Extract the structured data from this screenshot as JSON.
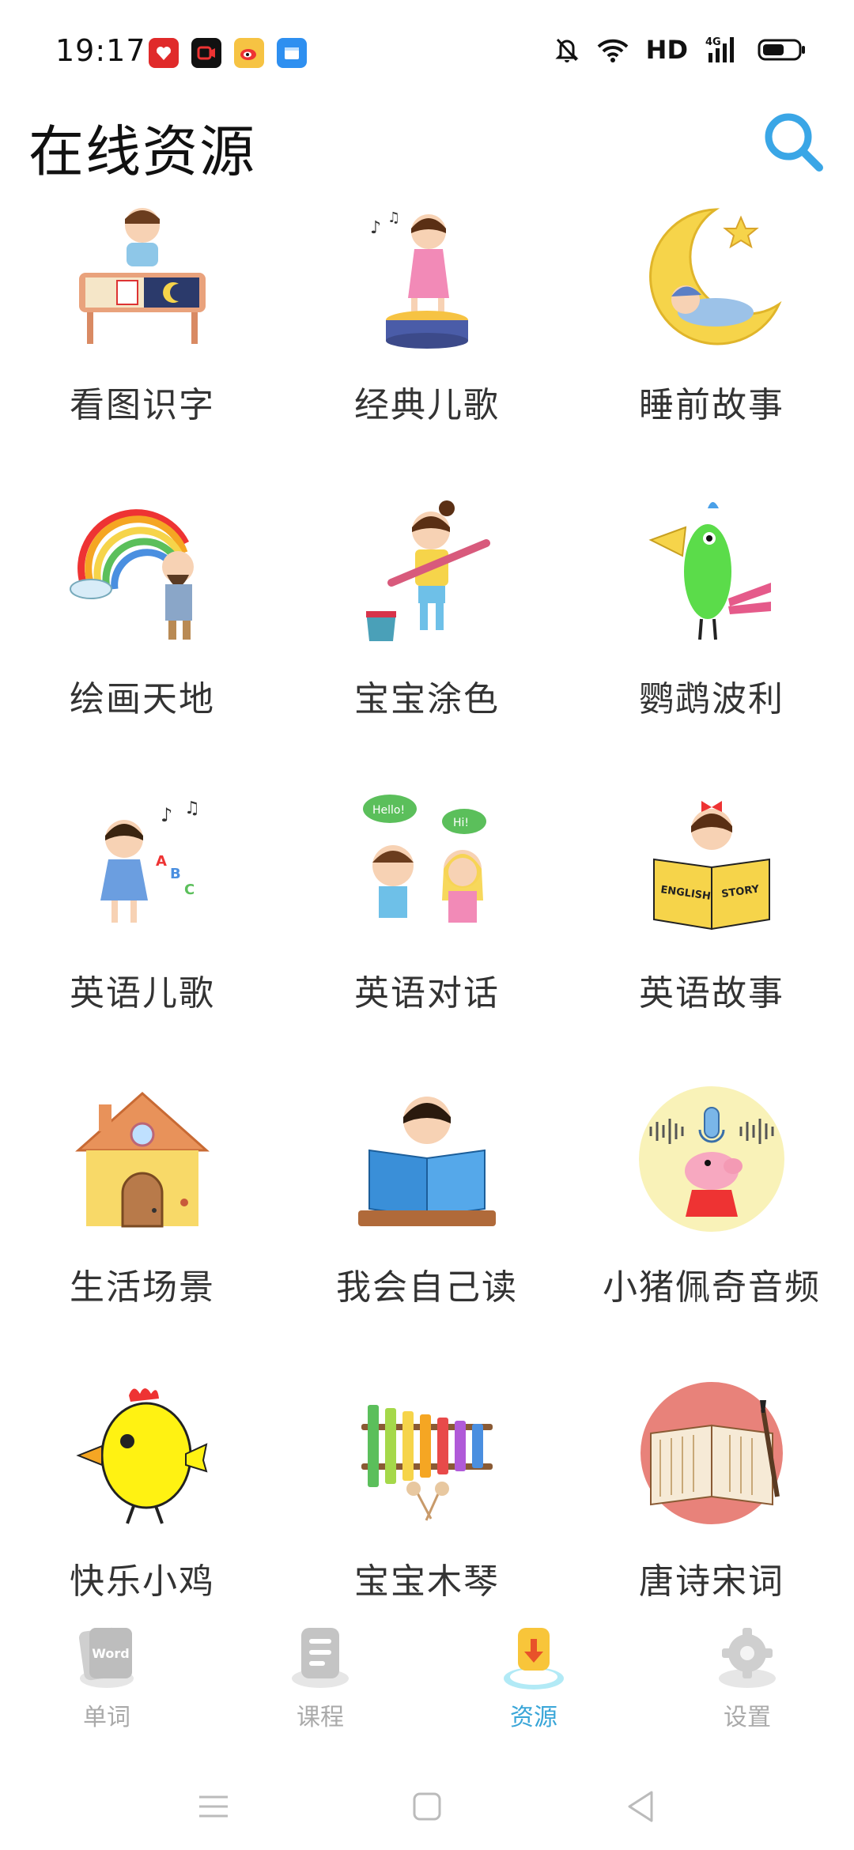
{
  "status_bar": {
    "time": "19:17",
    "network": "HD",
    "signal": "4G"
  },
  "header": {
    "title": "在线资源"
  },
  "grid": [
    {
      "label": "看图识字",
      "icon": "kid-at-desk-icon"
    },
    {
      "label": "经典儿歌",
      "icon": "girl-singing-icon"
    },
    {
      "label": "睡前故事",
      "icon": "moon-baby-icon"
    },
    {
      "label": "绘画天地",
      "icon": "rainbow-painter-icon"
    },
    {
      "label": "宝宝涂色",
      "icon": "girl-with-brush-icon"
    },
    {
      "label": "鹦鹉波利",
      "icon": "parrot-icon"
    },
    {
      "label": "英语儿歌",
      "icon": "girl-abc-icon"
    },
    {
      "label": "英语对话",
      "icon": "kids-hello-icon"
    },
    {
      "label": "英语故事",
      "icon": "english-story-book-icon"
    },
    {
      "label": "生活场景",
      "icon": "house-icon"
    },
    {
      "label": "我会自己读",
      "icon": "boy-reading-icon"
    },
    {
      "label": "小猪佩奇音频",
      "icon": "pig-microphone-icon"
    },
    {
      "label": "快乐小鸡",
      "icon": "chick-icon"
    },
    {
      "label": "宝宝木琴",
      "icon": "xylophone-icon"
    },
    {
      "label": "唐诗宋词",
      "icon": "scroll-book-icon"
    }
  ],
  "bottom_nav": [
    {
      "label": "单词",
      "badge": "Word",
      "active": false
    },
    {
      "label": "课程",
      "active": false
    },
    {
      "label": "资源",
      "active": true
    },
    {
      "label": "设置",
      "active": false
    }
  ],
  "colors": {
    "accent": "#3aa6d8",
    "nav_inactive": "#aaaaaa",
    "search": "#3aa6e6"
  }
}
